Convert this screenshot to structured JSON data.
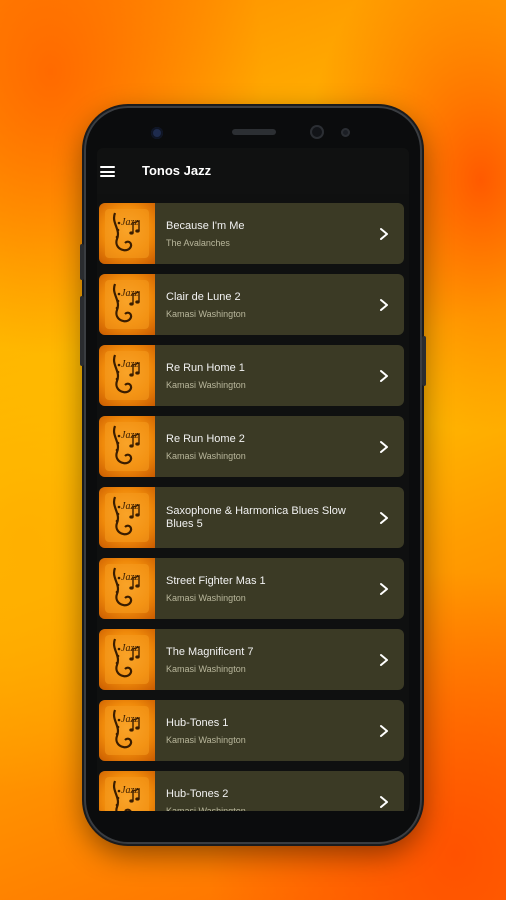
{
  "app": {
    "title": "Tonos Jazz"
  },
  "icons": {
    "menu": "hamburger-menu-icon",
    "row_action": "chevron-right-icon",
    "thumbnail": "jazz-saxophone-artwork"
  },
  "colors": {
    "row_bg": "#3b3a25",
    "appbar_bg": "#101111",
    "accent": "#f08a0a"
  },
  "tracks": [
    {
      "title": "Because I'm Me",
      "artist": "The Avalanches"
    },
    {
      "title": "Clair de Lune 2",
      "artist": "Kamasi Washington"
    },
    {
      "title": "Re Run Home 1",
      "artist": "Kamasi Washington"
    },
    {
      "title": "Re Run Home 2",
      "artist": "Kamasi Washington"
    },
    {
      "title": "Saxophone & Harmonica Blues Slow Blues 5",
      "artist": ""
    },
    {
      "title": "Street Fighter Mas 1",
      "artist": "Kamasi Washington"
    },
    {
      "title": "The Magnificent 7",
      "artist": "Kamasi Washington"
    },
    {
      "title": "Hub-Tones 1",
      "artist": "Kamasi Washington"
    },
    {
      "title": "Hub-Tones 2",
      "artist": "Kamasi Washington"
    }
  ]
}
